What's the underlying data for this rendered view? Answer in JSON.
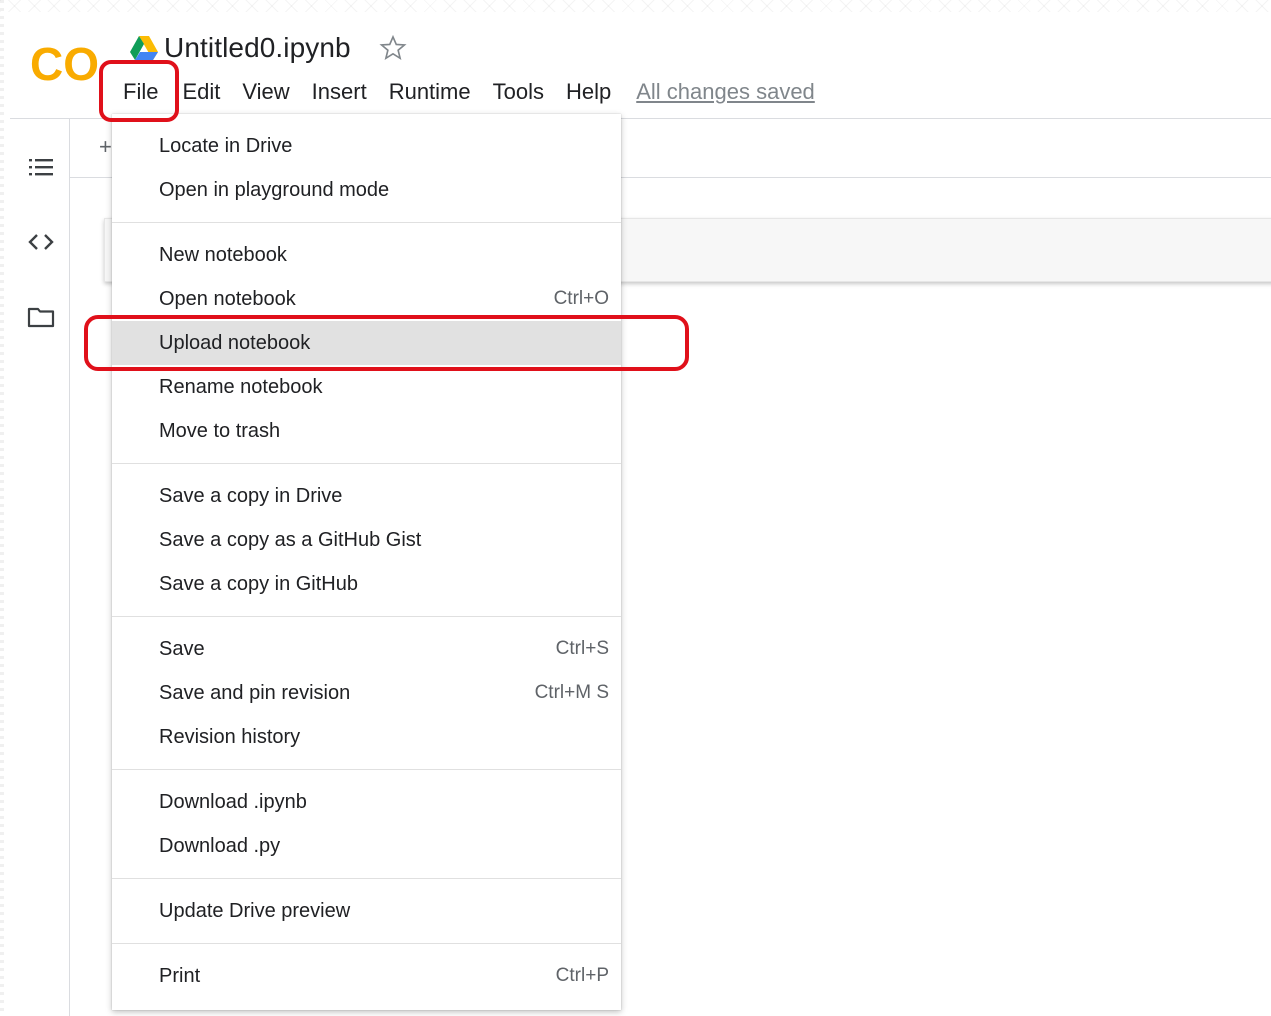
{
  "header": {
    "logo": "CO",
    "title": "Untitled0.ipynb",
    "save_status": "All changes saved",
    "icons": {
      "drive": "google-drive-icon",
      "star": "star-outline-icon"
    }
  },
  "menubar": {
    "items": [
      {
        "label": "File"
      },
      {
        "label": "Edit"
      },
      {
        "label": "View"
      },
      {
        "label": "Insert"
      },
      {
        "label": "Runtime"
      },
      {
        "label": "Tools"
      },
      {
        "label": "Help"
      }
    ]
  },
  "toolbar": {
    "add_label": "+"
  },
  "sidebar": {
    "icons": [
      "table-of-contents-icon",
      "code-snippets-icon",
      "files-folder-icon"
    ]
  },
  "file_menu": {
    "highlighted": "Upload notebook",
    "items": [
      {
        "label": "Locate in Drive",
        "shortcut": ""
      },
      {
        "label": "Open in playground mode",
        "shortcut": ""
      },
      {
        "label": "New notebook",
        "shortcut": ""
      },
      {
        "label": "Open notebook",
        "shortcut": "Ctrl+O"
      },
      {
        "label": "Upload notebook",
        "shortcut": ""
      },
      {
        "label": "Rename notebook",
        "shortcut": ""
      },
      {
        "label": "Move to trash",
        "shortcut": ""
      },
      {
        "label": "Save a copy in Drive",
        "shortcut": ""
      },
      {
        "label": "Save a copy as a GitHub Gist",
        "shortcut": ""
      },
      {
        "label": "Save a copy in GitHub",
        "shortcut": ""
      },
      {
        "label": "Save",
        "shortcut": "Ctrl+S"
      },
      {
        "label": "Save and pin revision",
        "shortcut": "Ctrl+M S"
      },
      {
        "label": "Revision history",
        "shortcut": ""
      },
      {
        "label": "Download .ipynb",
        "shortcut": ""
      },
      {
        "label": "Download .py",
        "shortcut": ""
      },
      {
        "label": "Update Drive preview",
        "shortcut": ""
      },
      {
        "label": "Print",
        "shortcut": "Ctrl+P"
      }
    ]
  },
  "colors": {
    "annotation_red": "#e0101a",
    "logo_orange": "#f9ab00",
    "logo_yellow": "#ffbd2e",
    "hover_gray": "#e1e1e1"
  }
}
